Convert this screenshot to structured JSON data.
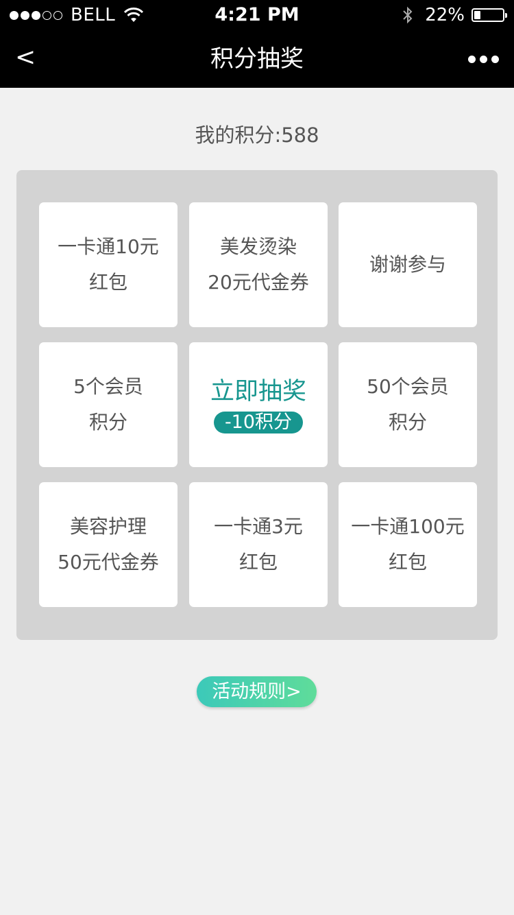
{
  "status_bar": {
    "carrier": "BELL",
    "time": "4:21 PM",
    "battery": "22%",
    "battery_level": 0.22,
    "signal_bars": 3,
    "signal_total": 5
  },
  "navbar": {
    "back": "<",
    "title": "积分抽奖"
  },
  "points": "我的积分:588",
  "grid": {
    "r0c0": [
      "一卡通10元",
      "红包"
    ],
    "r0c1": [
      "美发烫染",
      "20元代金券"
    ],
    "r0c2": [
      "谢谢参与"
    ],
    "r1c0": [
      "5个会员",
      "积分"
    ],
    "r1c1": {
      "title": "立即抽奖",
      "cost": "-10积分"
    },
    "r1c2": [
      "50个会员",
      "积分"
    ],
    "r2c0": [
      "美容护理",
      "50元代金券"
    ],
    "r2c1": [
      "一卡通3元",
      "红包"
    ],
    "r2c2": [
      "一卡通100元",
      "红包"
    ]
  },
  "rules_button": "活动规则>",
  "colors": {
    "accent": "#17968f",
    "rules_gradient_start": "#3cc9b9",
    "rules_gradient_end": "#5fdc9a",
    "background": "#f1f1f1",
    "board": "#d3d3d3"
  }
}
